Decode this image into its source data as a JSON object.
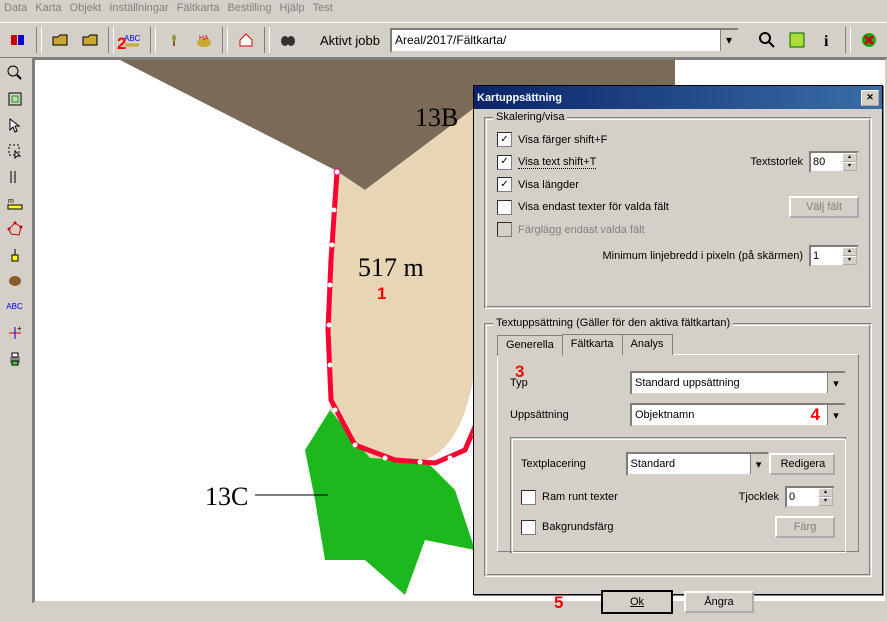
{
  "menu": {
    "items": [
      "Data",
      "Karta",
      "Objekt",
      "Inställningar",
      "Fältkarta",
      "Bestilling",
      "Hjälp",
      "Test"
    ]
  },
  "toolbar": {
    "job_label": "Aktivt jobb",
    "job_value": "Areal/2017/Fältkarta/"
  },
  "map": {
    "label_13b": "13B",
    "label_13c": "13C",
    "length": "517 m"
  },
  "markers": {
    "m1": "1",
    "m2": "2",
    "m3": "3",
    "m4": "4",
    "m5": "5"
  },
  "dialog": {
    "title": "Kartuppsättning",
    "group_scale": "Skalering/visa",
    "chk_colors": "Visa färger  shift+F",
    "chk_text": "Visa text  shift+T",
    "chk_lengths": "Visa längder",
    "chk_only_sel": "Visa endast texter för valda fält",
    "chk_color_sel": "Färglägg endast valda fält",
    "textsize_label": "Textstorlek",
    "textsize_val": "80",
    "btn_select_fields": "Välj fält",
    "minline_label": "Minimum linjebredd i pixeln (på skärmen)",
    "minline_val": "1",
    "group_text": "Textuppsättning  (Gäller för den aktiva fältkartan)",
    "tab_general": "Generella",
    "tab_fieldmap": "Fältkarta",
    "tab_analysis": "Analys",
    "lbl_type": "Typ",
    "val_type": "Standard uppsättning",
    "lbl_setup": "Uppsättning",
    "val_setup": "Objektnamn",
    "lbl_textplace": "Textplacering",
    "val_textplace": "Standard",
    "btn_edit": "Redigera",
    "chk_frame": "Ram runt texter",
    "lbl_thick": "Tjocklek",
    "val_thick": "0",
    "chk_bgcolor": "Bakgrundsfärg",
    "btn_color": "Färg",
    "btn_ok": "Ok",
    "btn_cancel": "Ångra"
  }
}
